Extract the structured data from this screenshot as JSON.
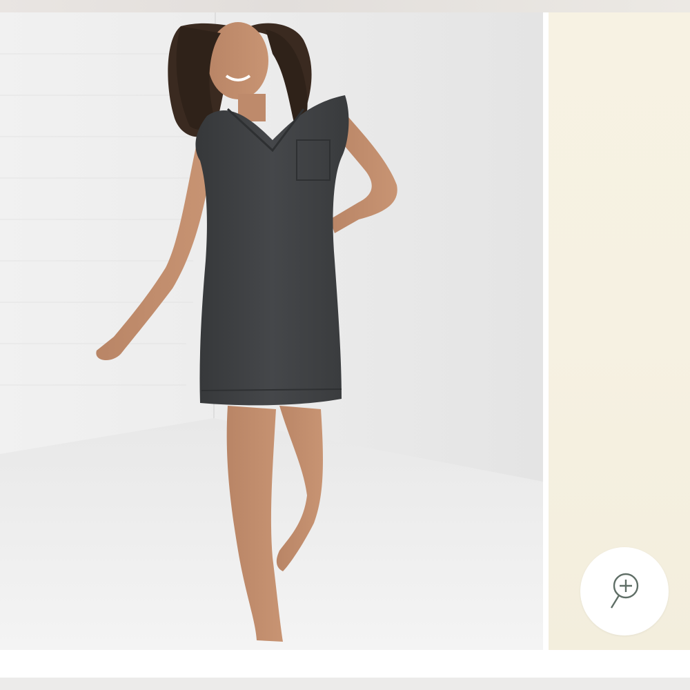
{
  "product_gallery": {
    "main_image": {
      "description_icon": "product-photo-model-grey-dress"
    },
    "next_image": {
      "description_icon": "product-photo-cream-background"
    },
    "zoom_button": {
      "icon": "zoom-in-icon"
    }
  },
  "colors": {
    "dress": "#3f4143",
    "zoom_icon": "#5f6e66",
    "next_slide_bg": "#f6f1e2"
  }
}
